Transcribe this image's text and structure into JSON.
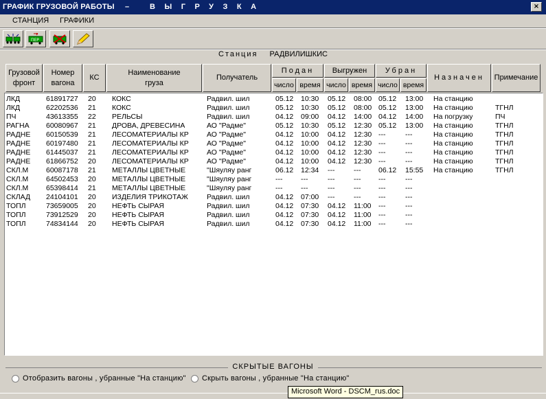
{
  "window": {
    "title_part1": "ГРАФИК ГРУЗОВОЙ РАБОТЫ",
    "title_dash": "–",
    "title_part2": "ВЫГРУЗКА",
    "close_label": "×"
  },
  "menu": {
    "items": [
      "СТАНЦИЯ",
      "ГРАФИКИ"
    ]
  },
  "toolbar": {
    "buttons": [
      {
        "icon": "train-cars-icon"
      },
      {
        "icon": "train-transfer-icon",
        "label": "ПЕР"
      },
      {
        "icon": "rejected-wagon-icon"
      },
      {
        "icon": "pencil-icon"
      }
    ]
  },
  "station": {
    "label": "Станция",
    "name": "РАДВИЛИШКИС"
  },
  "columns": {
    "front": "Грузовой фронт",
    "wagon": "Номер вагона",
    "ks": "КС",
    "cargo": "Наименование груза",
    "recipient": "Получатель",
    "submitted": "Подан",
    "unloaded": "Выгружен",
    "removed": "Убран",
    "assigned": "Назначен",
    "note": "Примечание",
    "date": "число",
    "time": "время"
  },
  "rows": [
    {
      "front": "ЛКД",
      "wagon": "61891727",
      "ks": "20",
      "cargo": "КОКС",
      "recipient": "Радвил. шил",
      "sub_d": "05.12",
      "sub_t": "10:30",
      "unl_d": "05.12",
      "unl_t": "08:00",
      "rem_d": "05.12",
      "rem_t": "13:00",
      "assigned": "На станцию",
      "note": ""
    },
    {
      "front": "ЛКД",
      "wagon": "62202536",
      "ks": "21",
      "cargo": "КОКС",
      "recipient": "Радвил. шил",
      "sub_d": "05.12",
      "sub_t": "10:30",
      "unl_d": "05.12",
      "unl_t": "08:00",
      "rem_d": "05.12",
      "rem_t": "13:00",
      "assigned": "На станцию",
      "note": "ТГНЛ"
    },
    {
      "front": "ПЧ",
      "wagon": "43613355",
      "ks": "22",
      "cargo": "РЕЛЬСЫ",
      "recipient": "Радвил. шил",
      "sub_d": "04.12",
      "sub_t": "09:00",
      "unl_d": "04.12",
      "unl_t": "14:00",
      "rem_d": "04.12",
      "rem_t": "14:00",
      "assigned": "На погрузку",
      "note": "ПЧ"
    },
    {
      "front": "РАГНА",
      "wagon": "60080967",
      "ks": "21",
      "cargo": "ДРОВА, ДРЕВЕСИНА",
      "recipient": "АО \"Радме\"",
      "sub_d": "05.12",
      "sub_t": "10:30",
      "unl_d": "05.12",
      "unl_t": "12:30",
      "rem_d": "05.12",
      "rem_t": "13:00",
      "assigned": "На станцию",
      "note": "ТГНЛ"
    },
    {
      "front": "РАДНЕ",
      "wagon": "60150539",
      "ks": "21",
      "cargo": "ЛЕСОМАТЕРИАЛЫ КР",
      "recipient": "АО \"Радме\"",
      "sub_d": "04.12",
      "sub_t": "10:00",
      "unl_d": "04.12",
      "unl_t": "12:30",
      "rem_d": "---",
      "rem_t": "---",
      "assigned": "На станцию",
      "note": "ТГНЛ"
    },
    {
      "front": "РАДНЕ",
      "wagon": "60197480",
      "ks": "21",
      "cargo": "ЛЕСОМАТЕРИАЛЫ КР",
      "recipient": "АО \"Радме\"",
      "sub_d": "04.12",
      "sub_t": "10:00",
      "unl_d": "04.12",
      "unl_t": "12:30",
      "rem_d": "---",
      "rem_t": "---",
      "assigned": "На станцию",
      "note": "ТГНЛ"
    },
    {
      "front": "РАДНЕ",
      "wagon": "61445037",
      "ks": "21",
      "cargo": "ЛЕСОМАТЕРИАЛЫ КР",
      "recipient": "АО \"Радме\"",
      "sub_d": "04.12",
      "sub_t": "10:00",
      "unl_d": "04.12",
      "unl_t": "12:30",
      "rem_d": "---",
      "rem_t": "---",
      "assigned": "На станцию",
      "note": "ТГНЛ"
    },
    {
      "front": "РАДНЕ",
      "wagon": "61866752",
      "ks": "20",
      "cargo": "ЛЕСОМАТЕРИАЛЫ КР",
      "recipient": "АО \"Радме\"",
      "sub_d": "04.12",
      "sub_t": "10:00",
      "unl_d": "04.12",
      "unl_t": "12:30",
      "rem_d": "---",
      "rem_t": "---",
      "assigned": "На станцию",
      "note": "ТГНЛ"
    },
    {
      "front": "СКЛ.М",
      "wagon": "60087178",
      "ks": "21",
      "cargo": "МЕТАЛЛЫ ЦВЕТНЫЕ",
      "recipient": "\"Шяуляу ранг",
      "sub_d": "06.12",
      "sub_t": "12:34",
      "unl_d": "---",
      "unl_t": "---",
      "rem_d": "06.12",
      "rem_t": "15:55",
      "assigned": "На станцию",
      "note": "ТГНЛ"
    },
    {
      "front": "СКЛ.М",
      "wagon": "64502453",
      "ks": "20",
      "cargo": "МЕТАЛЛЫ ЦВЕТНЫЕ",
      "recipient": "\"Шяуляу ранг",
      "sub_d": "---",
      "sub_t": "---",
      "unl_d": "---",
      "unl_t": "---",
      "rem_d": "---",
      "rem_t": "---",
      "assigned": "",
      "note": ""
    },
    {
      "front": "СКЛ.М",
      "wagon": "65398414",
      "ks": "21",
      "cargo": "МЕТАЛЛЫ ЦВЕТНЫЕ",
      "recipient": "\"Шяуляу ранг",
      "sub_d": "---",
      "sub_t": "---",
      "unl_d": "---",
      "unl_t": "---",
      "rem_d": "---",
      "rem_t": "---",
      "assigned": "",
      "note": ""
    },
    {
      "front": "СКЛАД",
      "wagon": "24104101",
      "ks": "20",
      "cargo": "ИЗДЕЛИЯ ТРИКОТАЖ",
      "recipient": "Радвил. шил",
      "sub_d": "04.12",
      "sub_t": "07:00",
      "unl_d": "---",
      "unl_t": "---",
      "rem_d": "---",
      "rem_t": "---",
      "assigned": "",
      "note": ""
    },
    {
      "front": "ТОПЛ",
      "wagon": "73659005",
      "ks": "20",
      "cargo": "НЕФТЬ СЫРАЯ",
      "recipient": "Радвил. шил",
      "sub_d": "04.12",
      "sub_t": "07:30",
      "unl_d": "04.12",
      "unl_t": "11:00",
      "rem_d": "---",
      "rem_t": "---",
      "assigned": "",
      "note": ""
    },
    {
      "front": "ТОПЛ",
      "wagon": "73912529",
      "ks": "20",
      "cargo": "НЕФТЬ СЫРАЯ",
      "recipient": "Радвил. шил",
      "sub_d": "04.12",
      "sub_t": "07:30",
      "unl_d": "04.12",
      "unl_t": "11:00",
      "rem_d": "---",
      "rem_t": "---",
      "assigned": "",
      "note": ""
    },
    {
      "front": "ТОПЛ",
      "wagon": "74834144",
      "ks": "20",
      "cargo": "НЕФТЬ СЫРАЯ",
      "recipient": "Радвил. шил",
      "sub_d": "04.12",
      "sub_t": "07:30",
      "unl_d": "04.12",
      "unl_t": "11:00",
      "rem_d": "---",
      "rem_t": "---",
      "assigned": "",
      "note": ""
    }
  ],
  "hidden": {
    "title": "СКРЫТЫЕ ВАГОНЫ",
    "option_show": "Отобразить вагоны , убранные  \"На станцию\"",
    "option_hide": "Скрыть  вагоны , убранные  \"На станцию\""
  },
  "tooltip": "Microsoft Word - DSCM_rus.doc"
}
